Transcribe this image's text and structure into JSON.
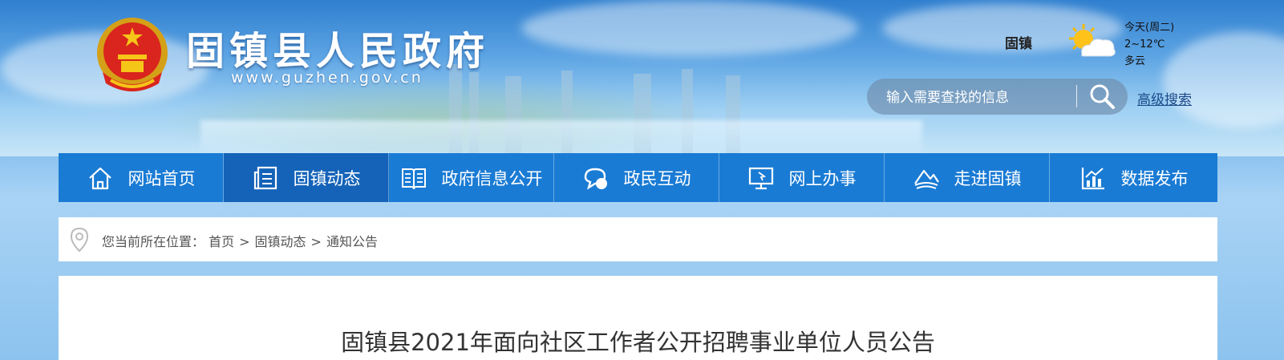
{
  "header": {
    "site_title": "固镇县人民政府",
    "site_url": "www.guzhen.gov.cn",
    "emblem_icon": "national-emblem-icon"
  },
  "weather": {
    "city": "固镇",
    "day": "今天(周二)",
    "temp": "2~12℃",
    "condition": "多云",
    "icon": "partly-cloudy-icon"
  },
  "search": {
    "placeholder": "输入需要查找的信息",
    "advanced_label": "高级搜索",
    "icon": "search-icon"
  },
  "nav": {
    "items": [
      {
        "label": "网站首页",
        "icon": "home-icon"
      },
      {
        "label": "固镇动态",
        "icon": "news-icon",
        "active": true
      },
      {
        "label": "政府信息公开",
        "icon": "book-icon"
      },
      {
        "label": "政民互动",
        "icon": "chat-icon"
      },
      {
        "label": "网上办事",
        "icon": "monitor-icon"
      },
      {
        "label": "走进固镇",
        "icon": "landscape-icon"
      },
      {
        "label": "数据发布",
        "icon": "chart-icon"
      }
    ],
    "color": "#1a7bd4",
    "active_color": "#1463b8"
  },
  "breadcrumb": {
    "prefix": "您当前所在位置：",
    "items": [
      "首页",
      "固镇动态",
      "通知公告"
    ],
    "separator": ">"
  },
  "article": {
    "title": "固镇县2021年面向社区工作者公开招聘事业单位人员公告"
  }
}
